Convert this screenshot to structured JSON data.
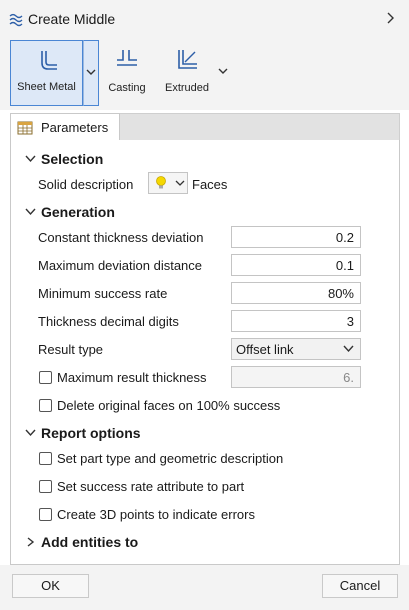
{
  "window": {
    "title": "Create Middle"
  },
  "toolbar": {
    "sheet_metal": "Sheet Metal",
    "casting": "Casting",
    "extruded": "Extruded"
  },
  "tabs": [
    {
      "label": "Parameters"
    }
  ],
  "selection": {
    "header": "Selection",
    "solid_description_label": "Solid description",
    "solid_description_value": "Faces"
  },
  "generation": {
    "header": "Generation",
    "constant_thickness_deviation": {
      "label": "Constant thickness deviation",
      "value": "0.2"
    },
    "maximum_deviation_distance": {
      "label": "Maximum deviation distance",
      "value": "0.1"
    },
    "minimum_success_rate": {
      "label": "Minimum success rate",
      "value": "80%"
    },
    "thickness_decimal_digits": {
      "label": "Thickness decimal digits",
      "value": "3"
    },
    "result_type": {
      "label": "Result type",
      "value": "Offset link"
    },
    "maximum_result_thickness": {
      "label": "Maximum result thickness",
      "value": "6.",
      "checked": false
    },
    "delete_original_faces": {
      "label": "Delete original faces on 100% success",
      "checked": false
    }
  },
  "report": {
    "header": "Report options",
    "set_part_type": {
      "label": "Set part type and geometric description",
      "checked": false
    },
    "set_success_rate": {
      "label": "Set success rate attribute to part",
      "checked": false
    },
    "create_3d_points": {
      "label": "Create 3D points to indicate errors",
      "checked": false
    }
  },
  "add_entities": {
    "header": "Add entities to"
  },
  "footer": {
    "ok": "OK",
    "cancel": "Cancel"
  },
  "colors": {
    "accent": "#4a86d4",
    "accent_bg": "#dde8f7",
    "icon_blue": "#2d5fa8"
  }
}
